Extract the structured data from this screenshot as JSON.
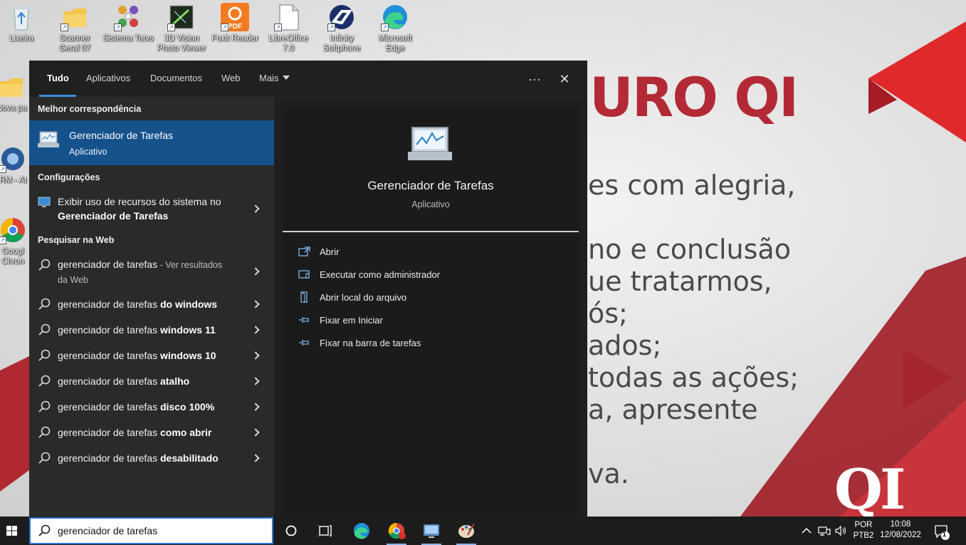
{
  "desktop": {
    "icons": [
      {
        "label": "Lixeira"
      },
      {
        "label": "Scanner Geral 07"
      },
      {
        "label": "Sistema Totvs"
      },
      {
        "label": "3D Vision Photo Viewer"
      },
      {
        "label": "Foxit Reader"
      },
      {
        "label": "LibreOffice 7.0"
      },
      {
        "label": "Infinity Softphone"
      },
      {
        "label": "Microsoft Edge"
      },
      {
        "label": "Nova pa"
      },
      {
        "label": "RM - At"
      },
      {
        "label": "Googl Chron"
      }
    ],
    "wallpaper": {
      "heading": "URO QI",
      "lines": [
        "es com alegria,",
        "no e conclusão",
        "ue tratarmos,",
        "ós;",
        "ados;",
        "todas as ações;",
        "a, apresente",
        "va."
      ],
      "logo": "QI"
    }
  },
  "search": {
    "tabs": [
      "Tudo",
      "Aplicativos",
      "Documentos",
      "Web",
      "Mais"
    ],
    "active_tab": "Tudo",
    "best_match_header": "Melhor correspondência",
    "best_match": {
      "name": "Gerenciador de Tarefas",
      "kind": "Aplicativo"
    },
    "settings_header": "Configurações",
    "setting": {
      "line1": "Exibir uso de recursos do sistema no",
      "line2": "Gerenciador de Tarefas"
    },
    "web_header": "Pesquisar na Web",
    "web_first": {
      "query": "gerenciador de tarefas",
      "suffix": " - Ver resultados",
      "suffix2": "da Web"
    },
    "suggestions": [
      {
        "prefix": "gerenciador de tarefas ",
        "bold": "do windows"
      },
      {
        "prefix": "gerenciador de tarefas ",
        "bold": "windows 11"
      },
      {
        "prefix": "gerenciador de tarefas ",
        "bold": "windows 10"
      },
      {
        "prefix": "gerenciador de tarefas ",
        "bold": "atalho"
      },
      {
        "prefix": "gerenciador de tarefas ",
        "bold": "disco 100%"
      },
      {
        "prefix": "gerenciador de tarefas ",
        "bold": "como abrir"
      },
      {
        "prefix": "gerenciador de tarefas ",
        "bold": "desabilitado"
      }
    ],
    "preview": {
      "name": "Gerenciador de Tarefas",
      "kind": "Aplicativo",
      "actions": [
        "Abrir",
        "Executar como administrador",
        "Abrir local do arquivo",
        "Fixar em Iniciar",
        "Fixar na barra de tarefas"
      ]
    },
    "header_buttons": {
      "more": "···",
      "close": "✕"
    }
  },
  "taskbar": {
    "search_value": "gerenciador de tarefas",
    "tray": {
      "language": "POR",
      "layout": "PTB2",
      "time": "10:08",
      "date": "12/08/2022",
      "notification_count": "1"
    }
  },
  "colors": {
    "accent": "#15528c",
    "wallpaper_red": "#b32a36"
  }
}
